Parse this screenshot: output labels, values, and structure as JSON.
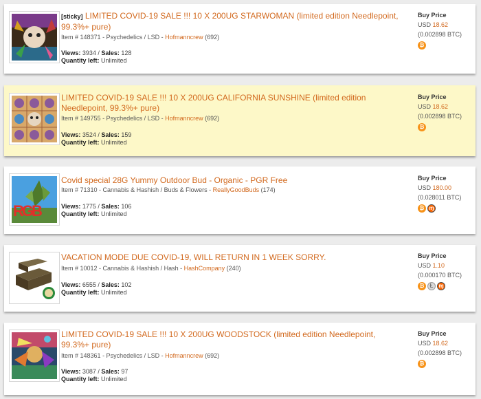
{
  "listings": [
    {
      "sticky": "[sticky]",
      "title": "LIMITED COVID-19 SALE !!! 10 X 200UG STARWOMAN (limited edition Needlepoint, 99.3%+ pure)",
      "item_prefix": "Item # ",
      "item_no": "148371",
      "category": " - Psychedelics / LSD - ",
      "vendor": "Hofmanncrew",
      "vendor_rating": " (692)",
      "views_label": "Views:",
      "views": " 3934 / ",
      "sales_label": "Sales:",
      "sales": " 128",
      "qty_label": "Quantity left:",
      "qty": " Unlimited",
      "price_label": "Buy Price",
      "price_currency": "USD ",
      "price_usd": "18.62",
      "price_btc": "(0.002898 BTC)"
    },
    {
      "title": "LIMITED COVID-19 SALE !!! 10 X 200UG CALIFORNIA SUNSHINE (limited edition Needlepoint, 99.3%+ pure)",
      "item_prefix": "Item # ",
      "item_no": "149755",
      "category": " - Psychedelics / LSD - ",
      "vendor": "Hofmanncrew",
      "vendor_rating": " (692)",
      "views_label": "Views:",
      "views": " 3524 / ",
      "sales_label": "Sales:",
      "sales": " 159",
      "qty_label": "Quantity left:",
      "qty": " Unlimited",
      "price_label": "Buy Price",
      "price_currency": "USD ",
      "price_usd": "18.62",
      "price_btc": "(0.002898 BTC)"
    },
    {
      "title": "Covid special 28G Yummy Outdoor Bud - Organic - PGR Free",
      "item_prefix": "Item # ",
      "item_no": "71310",
      "category": " - Cannabis & Hashish / Buds & Flowers - ",
      "vendor": "ReallyGoodBuds",
      "vendor_rating": " (174)",
      "views_label": "Views:",
      "views": " 1775 / ",
      "sales_label": "Sales:",
      "sales": " 106",
      "qty_label": "Quantity left:",
      "qty": " Unlimited",
      "price_label": "Buy Price",
      "price_currency": "USD ",
      "price_usd": "180.00",
      "price_btc": "(0.028011 BTC)",
      "thumb_text": "RGB"
    },
    {
      "title": "VACATION MODE DUE COVID-19, WILL RETURN IN 1 WEEK SORRY.",
      "item_prefix": "Item # ",
      "item_no": "10012",
      "category": " - Cannabis & Hashish / Hash - ",
      "vendor": "HashCompany",
      "vendor_rating": " (240)",
      "views_label": "Views:",
      "views": " 6555 / ",
      "sales_label": "Sales:",
      "sales": " 102",
      "qty_label": "Quantity left:",
      "qty": " Unlimited",
      "price_label": "Buy Price",
      "price_currency": "USD ",
      "price_usd": "1.10",
      "price_btc": "(0.000170 BTC)"
    },
    {
      "title": "LIMITED COVID-19 SALE !!! 10 X 200UG WOODSTOCK (limited edition Needlepoint, 99.3%+ pure)",
      "item_prefix": "Item # ",
      "item_no": "148361",
      "category": " - Psychedelics / LSD - ",
      "vendor": "Hofmanncrew",
      "vendor_rating": " (692)",
      "views_label": "Views:",
      "views": " 3087 / ",
      "sales_label": "Sales:",
      "sales": " 97",
      "qty_label": "Quantity left:",
      "qty": " Unlimited",
      "price_label": "Buy Price",
      "price_currency": "USD ",
      "price_usd": "18.62",
      "price_btc": "(0.002898 BTC)"
    }
  ],
  "coin_icons": {
    "bitcoin": "bitcoin-icon",
    "litecoin": "litecoin-icon",
    "monero": "monero-icon"
  },
  "colors": {
    "accent": "#d2691e",
    "highlight": "#fdf8c8",
    "bitcoin": "#f7931a",
    "monero": "#ff6600"
  }
}
